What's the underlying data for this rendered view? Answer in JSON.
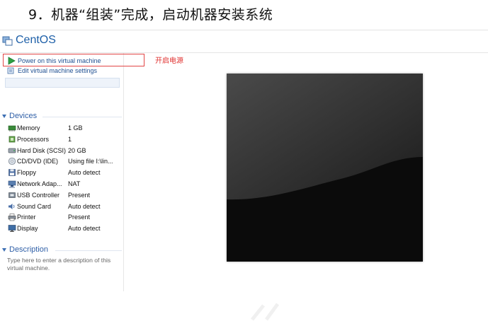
{
  "doc": {
    "heading": "9．机器“组装”完成，启动机器安装系统",
    "annotation": "开启电源"
  },
  "vm": {
    "title": "CentOS",
    "actions": {
      "power_on": "Power on this virtual machine",
      "edit_settings": "Edit virtual machine settings"
    },
    "devices_header": "Devices",
    "devices": [
      {
        "name": "Memory",
        "value": "1 GB",
        "icon": "memory-icon"
      },
      {
        "name": "Processors",
        "value": "1",
        "icon": "processor-icon"
      },
      {
        "name": "Hard Disk (SCSI)",
        "value": "20 GB",
        "icon": "hard-disk-icon"
      },
      {
        "name": "CD/DVD (IDE)",
        "value": "Using file I:\\lin...",
        "icon": "cd-dvd-icon"
      },
      {
        "name": "Floppy",
        "value": "Auto detect",
        "icon": "floppy-icon"
      },
      {
        "name": "Network Adap...",
        "value": "NAT",
        "icon": "network-adapter-icon"
      },
      {
        "name": "USB Controller",
        "value": "Present",
        "icon": "usb-controller-icon"
      },
      {
        "name": "Sound Card",
        "value": "Auto detect",
        "icon": "sound-card-icon"
      },
      {
        "name": "Printer",
        "value": "Present",
        "icon": "printer-icon"
      },
      {
        "name": "Display",
        "value": "Auto detect",
        "icon": "display-icon"
      }
    ],
    "description_header": "Description",
    "description_placeholder": "Type here to enter a description of this virtual machine."
  },
  "colors": {
    "accent": "#2f5fa7",
    "link": "#1e4f91",
    "annotation": "#e0312f",
    "power_green": "#2ea043",
    "console_bg": "#0b0b0b"
  }
}
